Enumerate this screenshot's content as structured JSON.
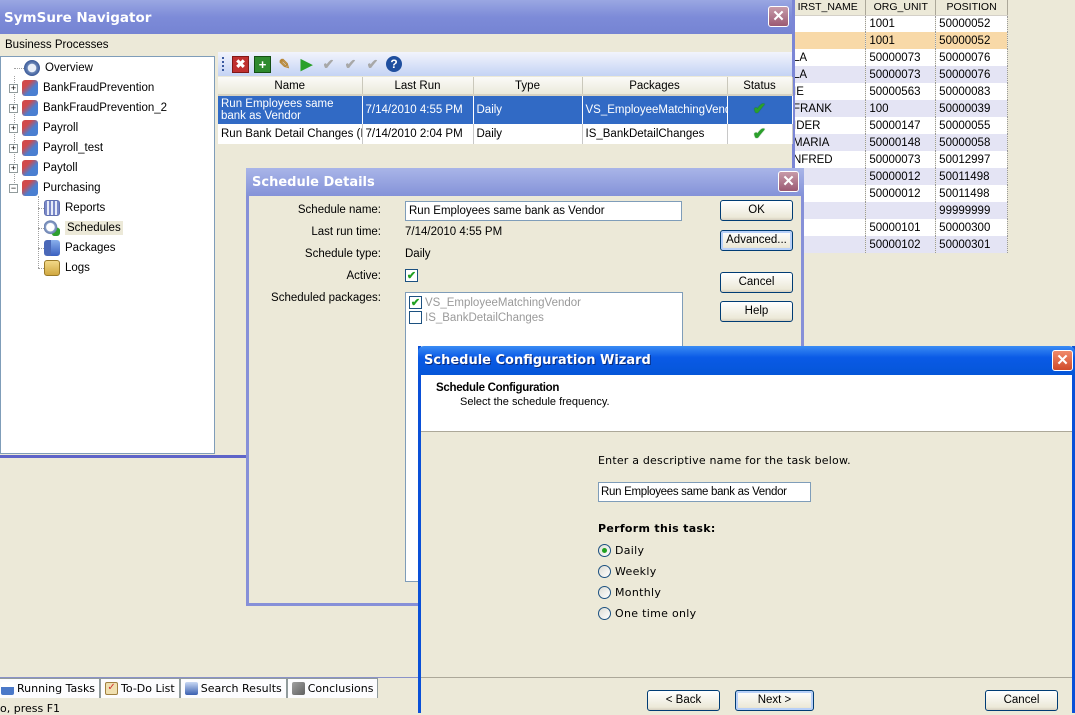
{
  "navigator": {
    "title": "SymSure Navigator",
    "close_label": "✕",
    "section_label": "Business Processes",
    "tree": [
      {
        "label": "Overview",
        "icon": "overview-icon",
        "expander": ""
      },
      {
        "label": "BankFraudPrevention",
        "icon": "process-icon",
        "expander": "+"
      },
      {
        "label": "BankFraudPrevention_2",
        "icon": "process-icon",
        "expander": "+"
      },
      {
        "label": "Payroll",
        "icon": "process-icon",
        "expander": "+"
      },
      {
        "label": "Payroll_test",
        "icon": "process-icon",
        "expander": "+"
      },
      {
        "label": "Paytoll",
        "icon": "process-icon",
        "expander": "+"
      },
      {
        "label": "Purchasing",
        "icon": "process-icon",
        "expander": "−"
      }
    ],
    "purchasing_children": [
      {
        "label": "Reports",
        "icon": "reports-icon"
      },
      {
        "label": "Schedules",
        "icon": "schedules-icon",
        "selected": true
      },
      {
        "label": "Packages",
        "icon": "packages-icon"
      },
      {
        "label": "Logs",
        "icon": "logs-icon"
      }
    ]
  },
  "toolbar": {
    "delete": "✖",
    "add": "+",
    "edit": "✎",
    "run": "▶",
    "disabled1": "✔",
    "disabled2": "✔",
    "disabled3": "✔",
    "help": "?"
  },
  "schedule_list": {
    "columns": [
      "Name",
      "Last Run",
      "Type",
      "Packages",
      "Status"
    ],
    "rows": [
      {
        "name": "Run Employees same bank as Vendor",
        "last_run": "7/14/2010 4:55 PM",
        "type": "Daily",
        "packages": "VS_EmployeeMatchingVendor",
        "status": "✔"
      },
      {
        "name": "Run Bank Detail Changes (I)",
        "last_run": "7/14/2010 2:04 PM",
        "type": "Daily",
        "packages": "IS_BankDetailChanges",
        "status": "✔"
      }
    ]
  },
  "bg_grid": {
    "columns": [
      "IRST_NAME",
      "ORG_UNIT",
      "POSITION"
    ],
    "rows": [
      [
        "",
        "1001",
        "50000052"
      ],
      [
        "",
        "1001",
        "50000052"
      ],
      [
        "LA",
        "50000073",
        "50000076"
      ],
      [
        "LA",
        "50000073",
        "50000076"
      ],
      [
        "IE",
        "50000563",
        "50000083"
      ],
      [
        "FRANK",
        "100",
        "50000039"
      ],
      [
        "IDER",
        "50000147",
        "50000055"
      ],
      [
        "MARIA",
        "50000148",
        "50000058"
      ],
      [
        "NFRED",
        "50000073",
        "50012997"
      ],
      [
        "",
        "50000012",
        "50011498"
      ],
      [
        "",
        "50000012",
        "50011498"
      ],
      [
        "",
        "",
        "99999999"
      ],
      [
        "",
        "50000101",
        "50000300"
      ],
      [
        "",
        "50000102",
        "50000301"
      ]
    ]
  },
  "schedule_details": {
    "title": "Schedule Details",
    "close_label": "✕",
    "labels": {
      "name": "Schedule name:",
      "last_run": "Last run time:",
      "type": "Schedule type:",
      "active": "Active:",
      "packages": "Scheduled packages:"
    },
    "values": {
      "name": "Run Employees same bank as Vendor",
      "last_run": "7/14/2010 4:55 PM",
      "type": "Daily",
      "active": true
    },
    "packages": [
      {
        "label": "VS_EmployeeMatchingVendor",
        "checked": true
      },
      {
        "label": "IS_BankDetailChanges",
        "checked": false
      }
    ],
    "buttons": {
      "ok": "OK",
      "advanced": "Advanced...",
      "cancel": "Cancel",
      "help": "Help"
    }
  },
  "wizard": {
    "title": "Schedule Configuration Wizard",
    "close_label": "✕",
    "header_title": "Schedule Configuration",
    "header_subtitle": "Select the schedule frequency.",
    "prompt": "Enter a descriptive name for the task below.",
    "task_name": "Run Employees same bank as Vendor",
    "perform_label": "Perform this task:",
    "options": [
      {
        "label": "Daily",
        "selected": true
      },
      {
        "label": "Weekly",
        "selected": false
      },
      {
        "label": "Monthly",
        "selected": false
      },
      {
        "label": "One time only",
        "selected": false
      }
    ],
    "buttons": {
      "back": "< Back",
      "next": "Next >",
      "cancel": "Cancel"
    }
  },
  "bottom_tabs": [
    "Running Tasks",
    "To-Do List",
    "Search Results",
    "Conclusions"
  ],
  "status_text": "o, press F1",
  "check_mark": "✔"
}
